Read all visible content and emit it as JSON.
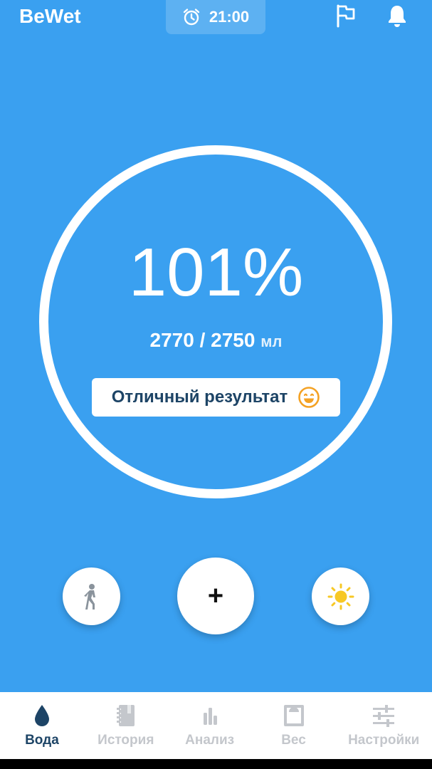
{
  "app": {
    "title": "BeWet"
  },
  "header": {
    "alarm_time": "21:00"
  },
  "progress": {
    "percent_text": "101%",
    "current": "2770",
    "separator": "/",
    "goal": "2750",
    "unit": "мл",
    "percent_value": 101
  },
  "status": {
    "message": "Отличный результат",
    "emoji": "smiling-face-icon"
  },
  "actions": {
    "walk": "walking-person-icon",
    "add": "+",
    "weather": "sun-icon"
  },
  "nav": {
    "items": [
      {
        "label": "Вода",
        "icon": "water-drop-icon",
        "active": true
      },
      {
        "label": "История",
        "icon": "notebook-icon",
        "active": false
      },
      {
        "label": "Анализ",
        "icon": "bar-chart-icon",
        "active": false
      },
      {
        "label": "Вес",
        "icon": "scale-icon",
        "active": false
      },
      {
        "label": "Настройки",
        "icon": "sliders-icon",
        "active": false
      }
    ]
  },
  "colors": {
    "background": "#3aa0f0",
    "accent_dark": "#1d4466",
    "inactive": "#c4c7cc",
    "emoji": "#f4a224",
    "sun": "#f7c825"
  }
}
